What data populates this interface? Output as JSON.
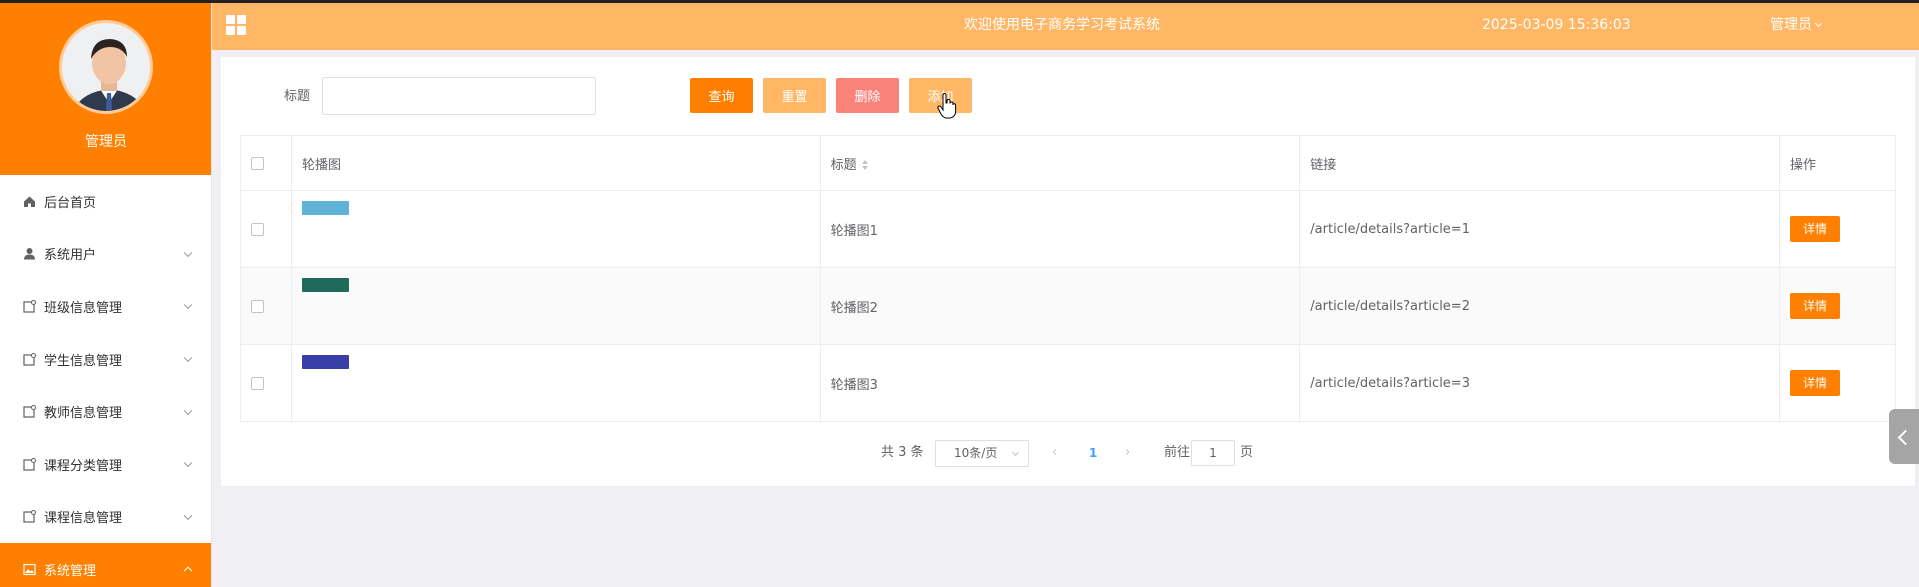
{
  "sidebar": {
    "profile_name": "管理员",
    "items": [
      {
        "label": "后台首页",
        "icon": "home-icon"
      },
      {
        "label": "系统用户",
        "icon": "user-icon"
      },
      {
        "label": "班级信息管理",
        "icon": "doc-icon"
      },
      {
        "label": "学生信息管理",
        "icon": "doc-icon"
      },
      {
        "label": "教师信息管理",
        "icon": "doc-icon"
      },
      {
        "label": "课程分类管理",
        "icon": "doc-icon"
      },
      {
        "label": "课程信息管理",
        "icon": "doc-icon"
      },
      {
        "label": "系统管理",
        "icon": "picture-icon"
      }
    ],
    "active_color": "#ff8000"
  },
  "header": {
    "title": "欢迎使用电子商务学习考试系统",
    "datetime": "2025-03-09 15:36:03",
    "user": "管理员",
    "bg_color": "#ffb766"
  },
  "search": {
    "label": "标题",
    "value": "",
    "placeholder": ""
  },
  "buttons": {
    "query": "查询",
    "reset": "重置",
    "delete": "删除",
    "add": "添加"
  },
  "table": {
    "columns": [
      "轮播图",
      "标题",
      "链接",
      "操作"
    ],
    "rows": [
      {
        "title": "轮播图1",
        "link": "/article/details?article=1",
        "action": "详情",
        "thumb_color": "#5fb3d6"
      },
      {
        "title": "轮播图2",
        "link": "/article/details?article=2",
        "action": "详情",
        "thumb_color": "#1f6a5a"
      },
      {
        "title": "轮播图3",
        "link": "/article/details?article=3",
        "action": "详情",
        "thumb_color": "#3a3fa8"
      }
    ]
  },
  "pagination": {
    "total": "共 3 条",
    "page_size": "10条/页",
    "current_page": "1",
    "goto_label": "前往",
    "goto_value": "1",
    "goto_unit": "页"
  }
}
